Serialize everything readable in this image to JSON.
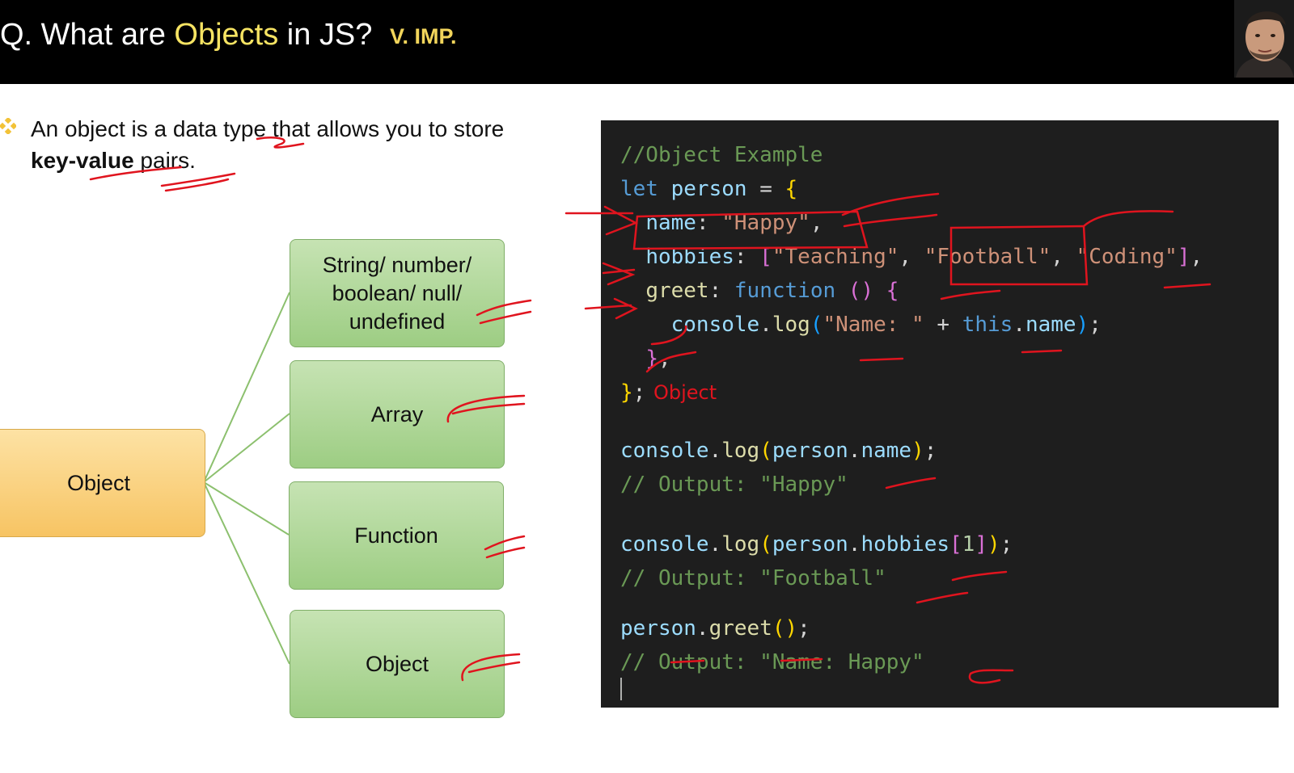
{
  "slide": {
    "title_prefix": "Q. What are ",
    "title_highlight": "Objects",
    "title_suffix": " in JS?",
    "importance_tag": "V. IMP."
  },
  "description": {
    "text_1": "An object is a data type that allows you to store ",
    "bold": "key-value",
    "text_2": " pairs."
  },
  "diagram": {
    "root": "Object",
    "children": [
      {
        "line1": "String/ number/",
        "line2": "boolean/ null/",
        "line3": "undefined"
      },
      {
        "label": "Array"
      },
      {
        "label": "Function"
      },
      {
        "label": "Object"
      }
    ]
  },
  "code": {
    "comment_header": "//Object Example",
    "kw_let": "let",
    "var_person": "person",
    "op_assign": " = ",
    "brace_open": "{",
    "key_name": "name",
    "val_happy": "\"Happy\"",
    "key_hobbies": "hobbies",
    "arr_teaching": "\"Teaching\"",
    "arr_football": "\"Football\"",
    "arr_coding": "\"Coding\"",
    "key_greet": "greet",
    "kw_function": "function",
    "console": "console",
    "log": "log",
    "str_name_label": "\"Name: \"",
    "kw_this": "this",
    "prop_name": "name",
    "out_happy": "// Output: \"Happy\"",
    "prop_hobbies": "hobbies",
    "index_1": "1",
    "out_football": "// Output: \"Football\"",
    "method_greet": "greet",
    "out_name_happy": "// Output: \"Name: Happy\""
  },
  "annotation": {
    "handwritten_text": "Object"
  },
  "colors": {
    "title_bar": "#000000",
    "title_highlight": "#f7e463",
    "importance_tag": "#f2d55b",
    "root_node": "#f7c463",
    "child_node": "#a9d491",
    "connector": "#8cc06e",
    "code_bg": "#1e1e1e",
    "ink": "#e0141e"
  }
}
